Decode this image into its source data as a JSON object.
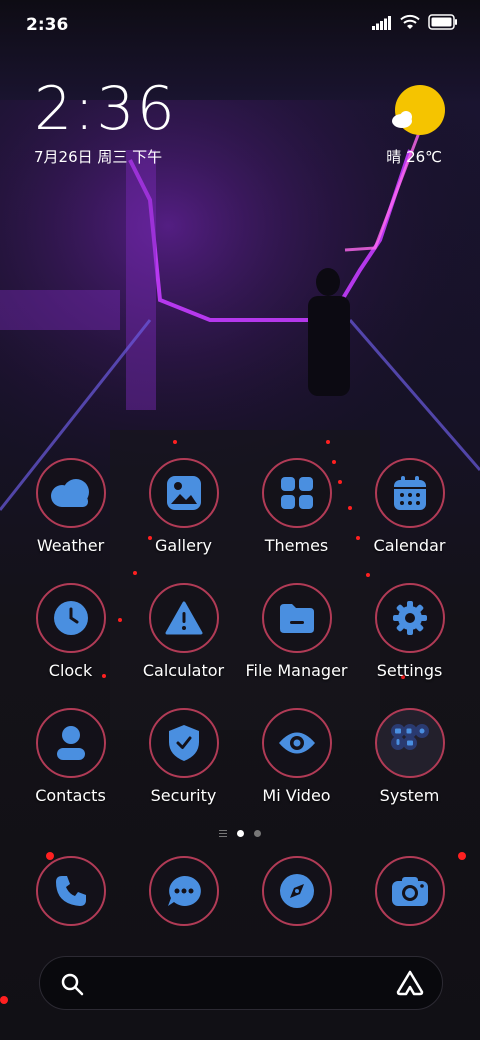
{
  "status_bar": {
    "time": "2:36",
    "icons": [
      "signal-icon",
      "wifi-icon",
      "battery-icon"
    ]
  },
  "clock_widget": {
    "time": "2:36",
    "date": "7月26日 周三 下午"
  },
  "weather_widget": {
    "condition": "晴",
    "temperature": "26℃",
    "weather_text": "晴 26℃",
    "icon": "sun-cloud-icon"
  },
  "apps": [
    {
      "label": "Weather",
      "icon": "cloud-icon"
    },
    {
      "label": "Gallery",
      "icon": "image-icon"
    },
    {
      "label": "Themes",
      "icon": "grid-icon"
    },
    {
      "label": "Calendar",
      "icon": "calendar-icon"
    },
    {
      "label": "Clock",
      "icon": "clock-icon"
    },
    {
      "label": "Calculator",
      "icon": "warning-icon"
    },
    {
      "label": "File Manager",
      "icon": "folder-icon"
    },
    {
      "label": "Settings",
      "icon": "gear-icon"
    },
    {
      "label": "Contacts",
      "icon": "person-icon"
    },
    {
      "label": "Security",
      "icon": "shield-icon"
    },
    {
      "label": "Mi Video",
      "icon": "eye-icon"
    },
    {
      "label": "System",
      "icon": "folder-apps-icon"
    }
  ],
  "page_indicator": {
    "pages": 2,
    "active": 1
  },
  "dock": [
    {
      "icon": "phone-icon"
    },
    {
      "icon": "message-icon"
    },
    {
      "icon": "compass-icon"
    },
    {
      "icon": "camera-icon"
    }
  ],
  "search_bar": {
    "icons": [
      "search-icon",
      "assistant-icon"
    ]
  },
  "colors": {
    "icon_blue": "#4a8fe0",
    "ring_red": "#b13b56",
    "sun_yellow": "#f5c400"
  }
}
